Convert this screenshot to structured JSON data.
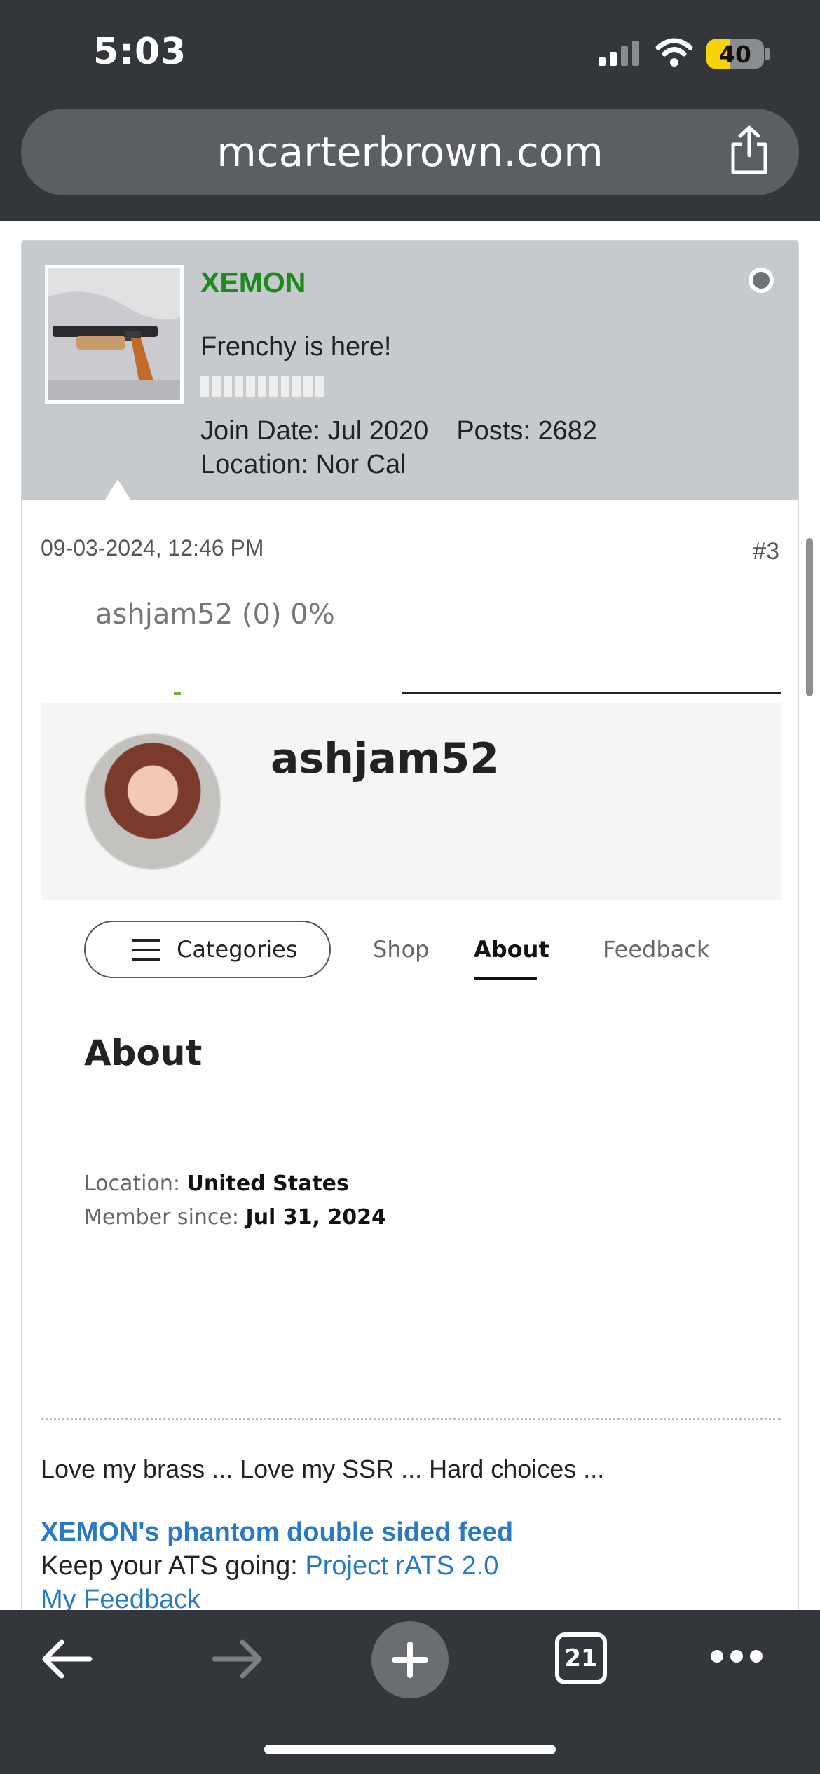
{
  "status_bar": {
    "time": "5:03",
    "battery": "40",
    "battery_level": 0.4,
    "battery_color": "#f6d30a"
  },
  "browser": {
    "url": "mcarterbrown.com",
    "tab_count": "21"
  },
  "post": {
    "username": "XEMON",
    "username_color": "#1c8a1c",
    "user_title": "Frenchy is here!",
    "join_date": "Join Date: Jul 2020",
    "posts": "Posts: 2682",
    "location": "Location: Nor Cal",
    "date": "09-03-2024, 12:46 PM",
    "post_number": "#3"
  },
  "embedded_screenshot": {
    "feedback_summary": "ashjam52 (0) 0%",
    "profile_name": "ashjam52",
    "nav": {
      "categories": "Categories",
      "shop": "Shop",
      "about": "About",
      "feedback": "Feedback"
    },
    "about_heading": "About",
    "location_label": "Location:",
    "location_value": "United States",
    "member_since_label": "Member since:",
    "member_since_value": "Jul 31, 2024"
  },
  "signature": {
    "line1": "Love my brass ... Love my SSR ... Hard choices ...",
    "link1": "XEMON's phantom double sided feed",
    "line2_prefix": "Keep your ATS going: ",
    "line2_link": "Project rATS 2.0",
    "link3": "My Feedback",
    "link_color": "#2a79c4"
  },
  "icons": {
    "signal": "cellular-signal-icon",
    "wifi": "wifi-icon",
    "share": "share-icon",
    "back": "arrow-left-icon",
    "forward": "arrow-right-icon",
    "new_tab": "plus-icon",
    "tabs": "tabs-icon",
    "more": "more-dots-icon",
    "online": "online-status-icon",
    "menu": "hamburger-menu-icon"
  }
}
